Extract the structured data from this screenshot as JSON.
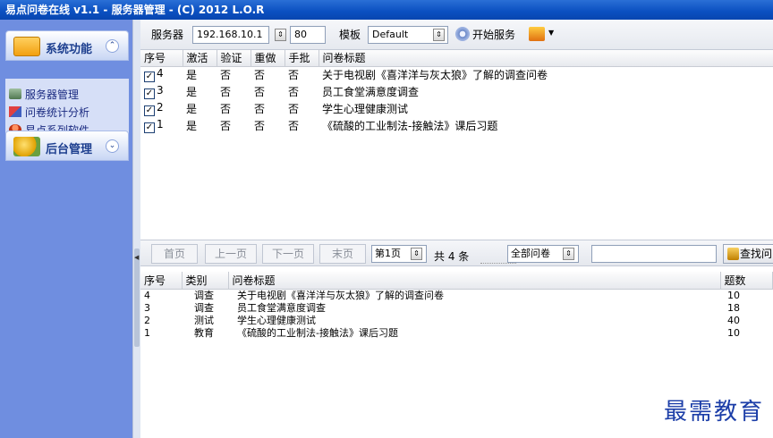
{
  "window": {
    "title": "易点问卷在线 v1.1 - 服务器管理 - (C) 2012 L.O.R"
  },
  "sidebar": {
    "group1": {
      "label": "系统功能",
      "chevron": "⌃",
      "icon": "folder-icon"
    },
    "items": [
      {
        "label": "服务器管理",
        "icon": "server-icon"
      },
      {
        "label": "问卷统计分析",
        "icon": "chart-icon"
      },
      {
        "label": "易点系列软件",
        "icon": "user-icon"
      }
    ],
    "group2": {
      "label": "后台管理",
      "chevron": "⌄",
      "icon": "gears-icon"
    }
  },
  "toolbar": {
    "server_label": "服务器",
    "server_ip": "192.168.10.1",
    "port": "80",
    "template_label": "模板",
    "template_value": "Default",
    "start_label": "开始服务"
  },
  "grid1": {
    "headers": [
      "序号",
      "激活",
      "验证",
      "重做",
      "手批",
      "问卷标题"
    ],
    "rows": [
      {
        "id": "4",
        "active": "是",
        "verify": "否",
        "redo": "否",
        "manual": "否",
        "title": "关于电视剧《喜洋洋与灰太狼》了解的调查问卷"
      },
      {
        "id": "3",
        "active": "是",
        "verify": "否",
        "redo": "否",
        "manual": "否",
        "title": "员工食堂满意度调查"
      },
      {
        "id": "2",
        "active": "是",
        "verify": "否",
        "redo": "否",
        "manual": "否",
        "title": "学生心理健康测试"
      },
      {
        "id": "1",
        "active": "是",
        "verify": "否",
        "redo": "否",
        "manual": "否",
        "title": "《硫酸的工业制法-接触法》课后习题"
      }
    ]
  },
  "pager": {
    "first": "首页",
    "prev": "上一页",
    "next": "下一页",
    "last": "末页",
    "page": "第1页",
    "total": "共 4 条",
    "filter": "全部问卷",
    "search_placeholder": "",
    "find": "查找问"
  },
  "grid2": {
    "headers": [
      "序号",
      "类别",
      "问卷标题",
      "题数"
    ],
    "rows": [
      {
        "id": "4",
        "type": "调查",
        "title": "关于电视剧《喜洋洋与灰太狼》了解的调查问卷",
        "count": "10"
      },
      {
        "id": "3",
        "type": "调查",
        "title": "员工食堂满意度调查",
        "count": "18"
      },
      {
        "id": "2",
        "type": "测试",
        "title": "学生心理健康测试",
        "count": "40"
      },
      {
        "id": "1",
        "type": "教育",
        "title": "《硫酸的工业制法-接触法》课后习题",
        "count": "10"
      }
    ]
  },
  "watermark": "最需教育"
}
